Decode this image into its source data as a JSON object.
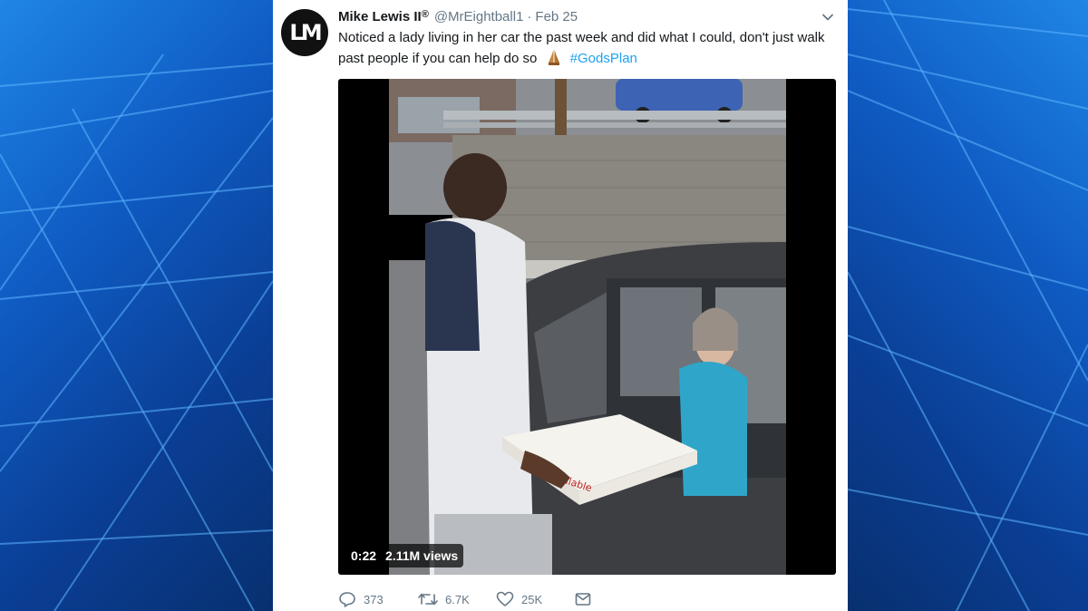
{
  "tweet": {
    "display_name": "Mike Lewis II",
    "verified_mark": "®",
    "handle": "@MrEightball1",
    "separator": "·",
    "date": "Feb 25",
    "text_part1": "Noticed a lady living in her car the past week and did what I could, don't just walk past people if you can help do so",
    "hashtag": "#GodsPlan",
    "emoji": "folded-hands-icon",
    "avatar_mark": "LM"
  },
  "media": {
    "type": "video",
    "duration": "0:22",
    "views": "2.11M views",
    "box_text": "Available"
  },
  "actions": {
    "replies": "373",
    "retweets": "6.7K",
    "likes": "25K"
  },
  "colors": {
    "link": "#1da1f2",
    "secondary_text": "#657786",
    "primary_text": "#14171a",
    "background_blue": "#0f5cc4"
  }
}
